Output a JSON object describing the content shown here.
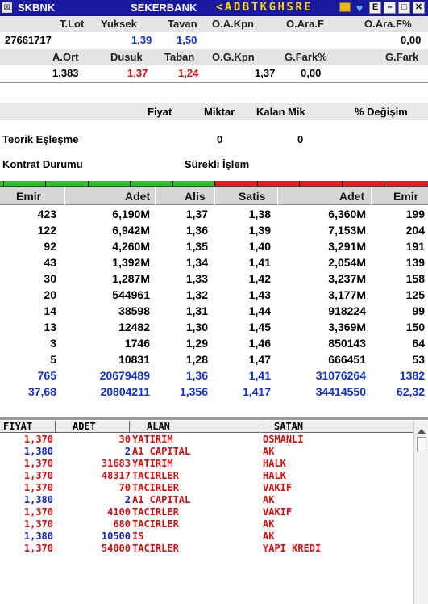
{
  "window": {
    "symbol": "SKBNK",
    "name": "SEKERBANK",
    "letters": "<ADBTKGHSRE",
    "buttons": [
      "E",
      "–",
      "□",
      "✕"
    ]
  },
  "summary": {
    "row1_labels": [
      "T.Lot",
      "Yuksek",
      "Tavan",
      "O.A.Kpn",
      "O.Ara.F",
      "O.Ara.F%"
    ],
    "row1_values": {
      "tlot": "27661717",
      "yuksek": "1,39",
      "tavan": "1,50",
      "oarafp": "0,00"
    },
    "row2_labels": [
      "A.Ort",
      "Dusuk",
      "Taban",
      "O.G.Kpn",
      "G.Fark%",
      "G.Fark"
    ],
    "row2_values": {
      "aort": "1,383",
      "dusuk": "1,37",
      "taban": "1,24",
      "ogkpn": "1,37",
      "gfarkp": "0,00"
    }
  },
  "fixing": {
    "headers": [
      "Fiyat",
      "Miktar",
      "Kalan Mik",
      "% Değişim"
    ],
    "teorik_label": "Teorik Eşleşme",
    "teorik_miktar": "0",
    "teorik_kalan": "0",
    "kontrat_label": "Kontrat Durumu",
    "kontrat_value": "Sürekli İşlem"
  },
  "depth_colors": {
    "bid": "#2cc02c",
    "ask": "#e02020"
  },
  "orderbook": {
    "headers": [
      "Emir",
      "Adet",
      "Alis",
      "Satis",
      "Adet",
      "Emir"
    ],
    "rows": [
      [
        "423",
        "6,190M",
        "1,37",
        "1,38",
        "6,360M",
        "199"
      ],
      [
        "122",
        "6,942M",
        "1,36",
        "1,39",
        "7,153M",
        "204"
      ],
      [
        "92",
        "4,260M",
        "1,35",
        "1,40",
        "3,291M",
        "191"
      ],
      [
        "43",
        "1,392M",
        "1,34",
        "1,41",
        "2,054M",
        "139"
      ],
      [
        "30",
        "1,287M",
        "1,33",
        "1,42",
        "3,237M",
        "158"
      ],
      [
        "20",
        "544961",
        "1,32",
        "1,43",
        "3,177M",
        "125"
      ],
      [
        "14",
        "38598",
        "1,31",
        "1,44",
        "918224",
        "99"
      ],
      [
        "13",
        "12482",
        "1,30",
        "1,45",
        "3,369M",
        "150"
      ],
      [
        "3",
        "1746",
        "1,29",
        "1,46",
        "850143",
        "64"
      ],
      [
        "5",
        "10831",
        "1,28",
        "1,47",
        "666451",
        "53"
      ]
    ],
    "totals": [
      [
        "765",
        "20679489",
        "1,36",
        "1,41",
        "31076264",
        "1382"
      ],
      [
        "37,68",
        "20804211",
        "1,356",
        "1,417",
        "34414550",
        "62,32"
      ]
    ]
  },
  "trades": {
    "headers": [
      "FIYAT",
      "ADET",
      "ALAN",
      "SATAN"
    ],
    "rows": [
      {
        "fiyat": "1,370",
        "adet": "30",
        "alan": "YATIRIM",
        "satan": "OSMANLI",
        "color": "red"
      },
      {
        "fiyat": "1,380",
        "adet": "2",
        "alan": "A1 CAPITAL",
        "satan": "AK",
        "color": "blue"
      },
      {
        "fiyat": "1,370",
        "adet": "31683",
        "alan": "YATIRIM",
        "satan": "HALK",
        "color": "red"
      },
      {
        "fiyat": "1,370",
        "adet": "48317",
        "alan": "TACIRLER",
        "satan": "HALK",
        "color": "red"
      },
      {
        "fiyat": "1,370",
        "adet": "70",
        "alan": "TACIRLER",
        "satan": "VAKIF",
        "color": "red"
      },
      {
        "fiyat": "1,380",
        "adet": "2",
        "alan": "A1 CAPITAL",
        "satan": "AK",
        "color": "blue"
      },
      {
        "fiyat": "1,370",
        "adet": "4100",
        "alan": "TACIRLER",
        "satan": "VAKIF",
        "color": "red"
      },
      {
        "fiyat": "1,370",
        "adet": "680",
        "alan": "TACIRLER",
        "satan": "AK",
        "color": "red"
      },
      {
        "fiyat": "1,380",
        "adet": "10500",
        "alan": "IS",
        "satan": "AK",
        "color": "blue"
      },
      {
        "fiyat": "1,370",
        "adet": "54000",
        "alan": "TACIRLER",
        "satan": "YAPI KREDI",
        "color": "red"
      }
    ]
  }
}
